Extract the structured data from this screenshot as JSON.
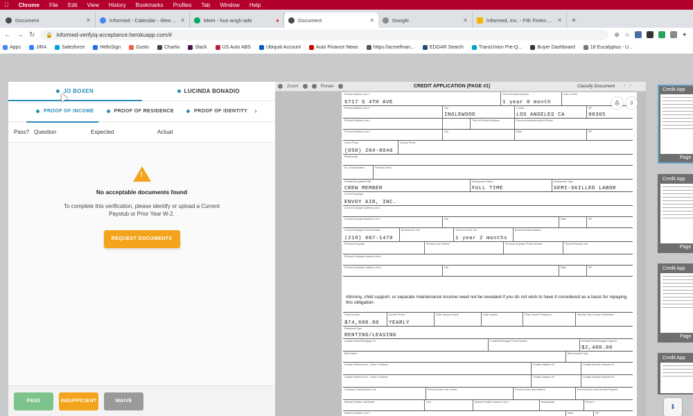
{
  "menubar": {
    "items": [
      "",
      "Chrome",
      "File",
      "Edit",
      "View",
      "History",
      "Bookmarks",
      "Profiles",
      "Tab",
      "Window",
      "Help"
    ]
  },
  "tabs": [
    {
      "title": "Document",
      "color": "#4a4a4a"
    },
    {
      "title": "Informed - Calendar - Week of...",
      "color": "#4285f4"
    },
    {
      "title": "Meet - hus-angh-ade",
      "color": "#00a862"
    },
    {
      "title": "Document",
      "color": "#4a4a4a",
      "active": true
    },
    {
      "title": "Google",
      "color": "#888888"
    },
    {
      "title": "Informed, Inc. - FIE Fintech A...",
      "color": "#f4b400"
    }
  ],
  "address": {
    "url": "informed-verifyiq-acceptance.herokuapp.com/#"
  },
  "bookmarks": [
    {
      "label": "Apps",
      "color": "#4285f4"
    },
    {
      "label": "JIRA",
      "color": "#2684ff"
    },
    {
      "label": "Salesforce",
      "color": "#00a1e0"
    },
    {
      "label": "HelloSign",
      "color": "#1e6ee8"
    },
    {
      "label": "Gusto",
      "color": "#f45d48"
    },
    {
      "label": "Chartio",
      "color": "#444444"
    },
    {
      "label": "Slack",
      "color": "#4a154b"
    },
    {
      "label": "US Auto ABS",
      "color": "#b22234"
    },
    {
      "label": "Ubiquiti Account",
      "color": "#0559c9"
    },
    {
      "label": "Auto Finance News",
      "color": "#cc0000"
    },
    {
      "label": "https://acmefinan...",
      "color": "#555555"
    },
    {
      "label": "EDGAR Search",
      "color": "#1f4e79"
    },
    {
      "label": "TransUnion Pre-Q...",
      "color": "#00a6ca"
    },
    {
      "label": "Buyer Dashboard",
      "color": "#333333"
    },
    {
      "label": "18 Eucalyptus - U...",
      "color": "#777777"
    }
  ],
  "applicants": [
    "JO BOXEN",
    "LUCINDA BONADIO"
  ],
  "proofs": [
    "PROOF OF INCOME",
    "PROOF OF RESIDENCE",
    "PROOF OF IDENTITY"
  ],
  "columns": {
    "pass": "Pass?",
    "question": "Question",
    "expected": "Expected",
    "actual": "Actual"
  },
  "empty_state": {
    "title": "No acceptable documents found",
    "message": "To complete this verification, please identify or upload a Current Paystub or Prior Year W-2.",
    "button": "REQUEST DOCUMENTS"
  },
  "footer_buttons": {
    "pass": "PASS",
    "fail": "INSUFFICIENT",
    "waive": "WAIVE"
  },
  "viewer": {
    "zoom": "Zoom",
    "rotate": "Rotate",
    "title": "CREDIT APPLICATION (PAGE #1)",
    "classify": "Classify Document"
  },
  "form": {
    "address": "6717 S 4TH AVE",
    "time_at_address": "1 year 0 month",
    "city": "INGLEWOOD",
    "county": "LOS ANGELES CA",
    "zip": "90305",
    "phone": "(650) 204-8040",
    "position": "CREW MEMBER",
    "employment_type": "FULL TIME",
    "occupation": "SEMI-SKILLED LABOR",
    "employer": "ENVOY AIR, INC.",
    "employer_phone": "(219) 607-1470",
    "time_at_job": "1 year 2 months",
    "notice": "Alimony, child support, or separate maintenance income need not be revealed if you do not wish to have it considered as a basis for repaying this obligation.",
    "gross_income": "$74,600.00",
    "frequency": "YEARLY",
    "residence_type": "RENTING/LEASING",
    "monthly_payment": "$2,400.00"
  },
  "thumbnails": [
    {
      "label": "Credit App",
      "page": "Page"
    },
    {
      "label": "Credit App",
      "page": "Page"
    },
    {
      "label": "Credit App",
      "page": "Page"
    },
    {
      "label": "Credit App",
      "page": ""
    }
  ],
  "colors": {
    "accent": "#2a8bb5",
    "orange": "#f3a41c",
    "pass_green": "#7dc48c",
    "waive_gray": "#9a9a9a",
    "menubar": "#b4002c"
  }
}
